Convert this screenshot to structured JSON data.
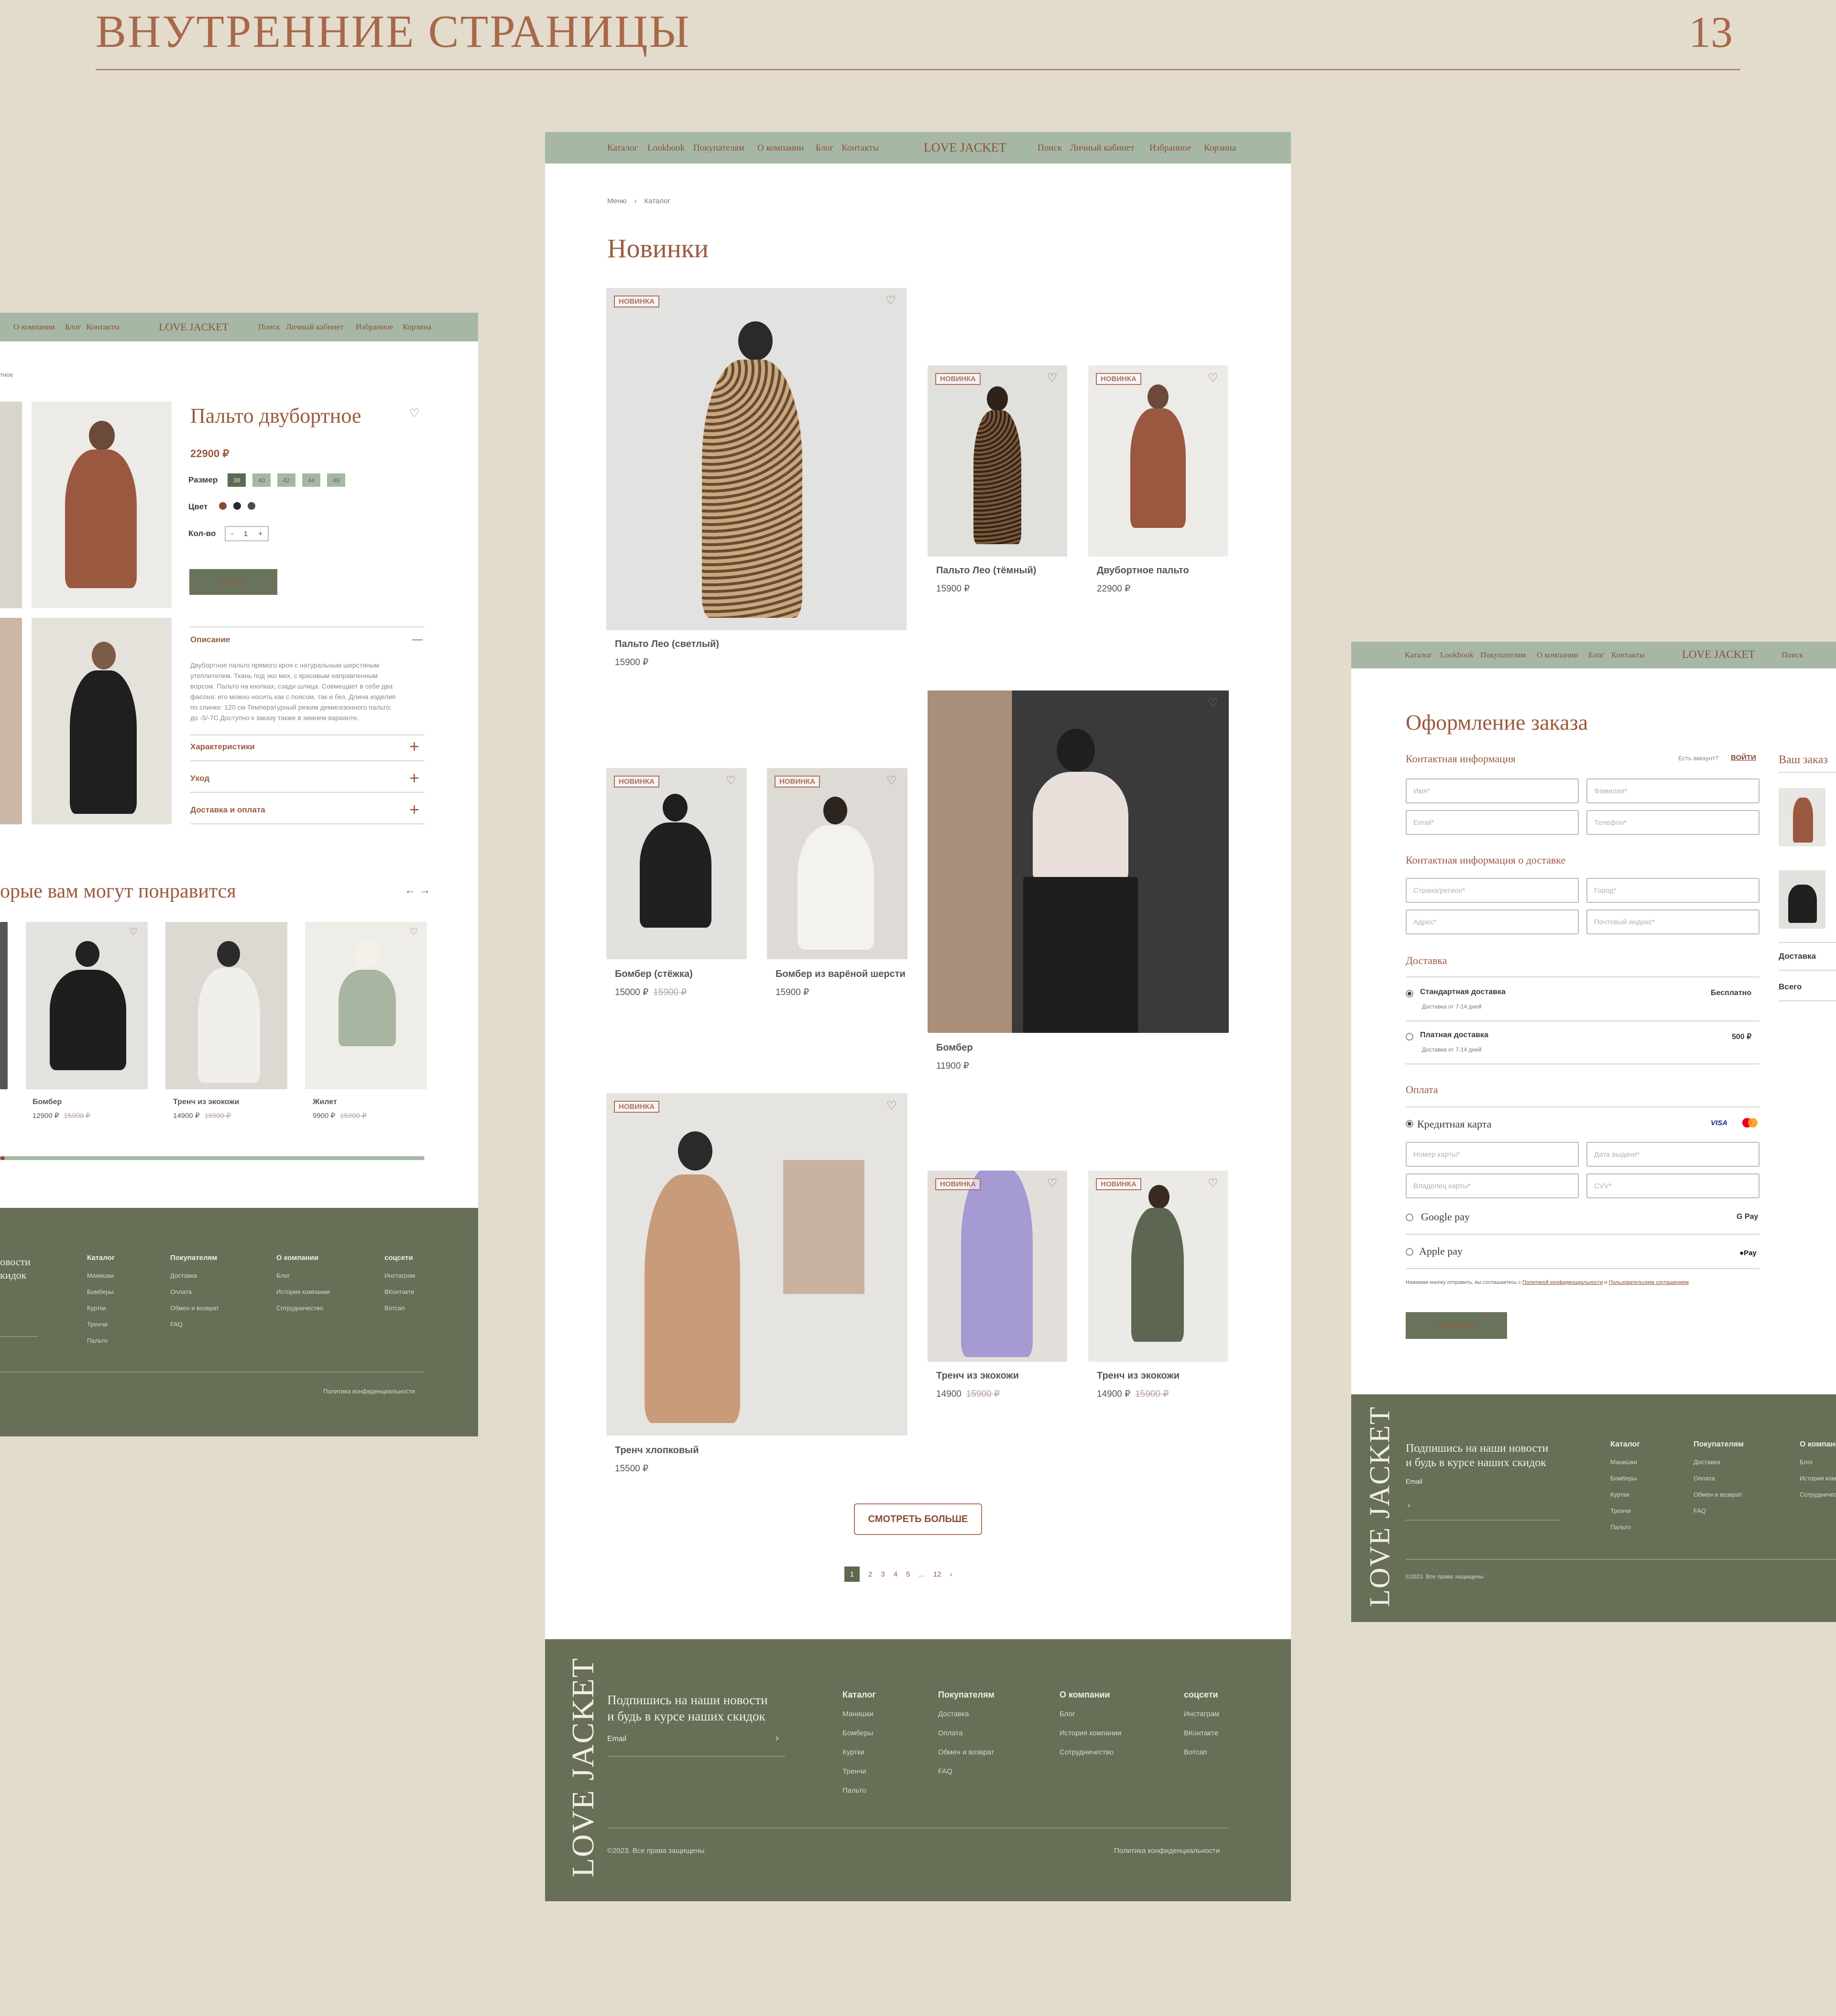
{
  "page": {
    "title": "ВНУТРЕННИЕ СТРАНИЦЫ",
    "number": "13"
  },
  "nav": {
    "logo": "LOVE JACKET",
    "left": [
      "Каталог",
      "Lookbook",
      "Покупателям",
      "О компании",
      "Блог",
      "Контакты"
    ],
    "right": [
      "Поиск",
      "Личный кабинет",
      "Избранное",
      "Корзина"
    ]
  },
  "catalog": {
    "breadcrumb": [
      "Меню",
      "Каталог"
    ],
    "heading": "Новинки",
    "badge": "НОВИНКА",
    "products": [
      {
        "name": "Пальто Лео (светлый)",
        "price": "15900 ₽",
        "old": ""
      },
      {
        "name": "Пальто Лео (тёмный)",
        "price": "15900 ₽",
        "old": ""
      },
      {
        "name": "Двубортное пальто",
        "price": "22900 ₽",
        "old": ""
      },
      {
        "name": "Бомбер (стёжка)",
        "price": "15000 ₽",
        "old": "15900 ₽"
      },
      {
        "name": "Бомбер из варёной шерсти",
        "price": "15900 ₽",
        "old": ""
      },
      {
        "name": "Бомбер",
        "price": "11900 ₽",
        "old": ""
      },
      {
        "name": "Тренч хлопковый",
        "price": "15500 ₽",
        "old": ""
      },
      {
        "name": "Тренч из экокожи",
        "price": "14900",
        "old": "15900 ₽"
      },
      {
        "name": "Тренч из экокожи",
        "price": "14900 ₽",
        "old": "15900 ₽"
      }
    ],
    "more_button": "СМОТРЕТЬ БОЛЬШЕ",
    "pagination": [
      "1",
      "2",
      "3",
      "4",
      "5",
      "...",
      "12"
    ]
  },
  "footer": {
    "logo": "LOVE JACKET",
    "subscribe_line1": "Подпишись на наши новости",
    "subscribe_line2": "и будь в курсе наших скидок",
    "email_label": "Email",
    "columns": [
      {
        "title": "Каталог",
        "items": [
          "Манишки",
          "Бомберы",
          "Куртки",
          "Тренчи",
          "Пальто"
        ]
      },
      {
        "title": "Покупателям",
        "items": [
          "Доставка",
          "Оплата",
          "Обмен и возврат",
          "FAQ"
        ]
      },
      {
        "title": "О компании",
        "items": [
          "Блог",
          "История компании",
          "Сотрудничество"
        ]
      },
      {
        "title": "соцсети",
        "items": [
          "Инстаграм",
          "ВКонтакте",
          "Вотсап"
        ]
      }
    ],
    "copyright": "©2023. Все права защищены",
    "privacy": "Политика конфиденциальности"
  },
  "product": {
    "breadcrumb_tail": "тное",
    "title": "Пальто двубортное",
    "price": "22900 ₽",
    "size_label": "Размер",
    "sizes": [
      "38",
      "40",
      "42",
      "44",
      "46"
    ],
    "color_label": "Цвет",
    "colors": [
      "#8a4a36",
      "#2a2a2a",
      "#4a4a4a"
    ],
    "qty_label": "Кол-во",
    "qty": "1",
    "qty_minus": "-",
    "qty_plus": "+",
    "buy": "Купить",
    "accordion": [
      {
        "title": "Описание",
        "sign": "—"
      },
      {
        "title": "Характеристики",
        "sign": "+"
      },
      {
        "title": "Уход",
        "sign": "+"
      },
      {
        "title": "Доставка и оплата",
        "sign": "+"
      }
    ],
    "desc": [
      "Двубортное пальто прямого кроя с натуральным шерстяным",
      "утеплителем. Ткань под эко мех, с красивым направленным",
      "ворсом. Пальто на кнопках, сзади шлица. Совмещает в себе два",
      "фасона: его можно носить как с поясом, так и без. Длина изделия",
      "по спинке: 120 см Температурный режим демисезонного пальто:",
      "до -5/-7С Доступно к заказу также в зимнем варианте."
    ],
    "related_title": "орые вам могут понравится",
    "arrows": "← →",
    "related": [
      {
        "name": "Бомбер",
        "price": "12900 ₽",
        "old": "15900 ₽"
      },
      {
        "name": "Тренч из экокожи",
        "price": "14900 ₽",
        "old": "15900 ₽"
      },
      {
        "name": "Жилет",
        "price": "9900 ₽",
        "old": "15900 ₽"
      }
    ],
    "footer_sub1": "овости",
    "footer_sub2": "кидок"
  },
  "checkout": {
    "title": "Оформление заказа",
    "contact": "Контактная информация",
    "have_account": "Есть аккаунт?",
    "login": "ВОЙТИ",
    "fields_contact": [
      "Имя*",
      "Фамилия*",
      "Email*",
      "Телефон*"
    ],
    "delivery_info": "Контактная информация о доставке",
    "fields_delivery": [
      "Страна/регион*",
      "Город*",
      "Адрес*",
      "Почтовый индекс*"
    ],
    "delivery": "Доставка",
    "opt1": "Стандартная доставка",
    "opt1_sub": "Доставка от 7-14 дней",
    "opt1_price": "Бесплатно",
    "opt2": "Платная доставка",
    "opt2_sub": "Доставка от 7-14 дней",
    "opt2_price": "500 ₽",
    "payment": "Оплата",
    "card": "Кредитная карта",
    "visa": "VISA",
    "fields_card": [
      "Номер карты*",
      "Дата выдачи*",
      "Владелец карты*",
      "CVV*"
    ],
    "gpay": "Google pay",
    "gpay_logo": "G Pay",
    "apay": "Apple pay",
    "apay_logo": "Pay",
    "consent": "Нажимая кнопку отправить, вы соглашаетесь с",
    "policy": "Политикой конфиденциальности",
    "and": "и",
    "agreement": "Пользовательским соглашением",
    "submit": "Отправить",
    "summary_title": "Ваш заказ",
    "summary_delivery": "Доставка",
    "summary_total": "Всего"
  }
}
